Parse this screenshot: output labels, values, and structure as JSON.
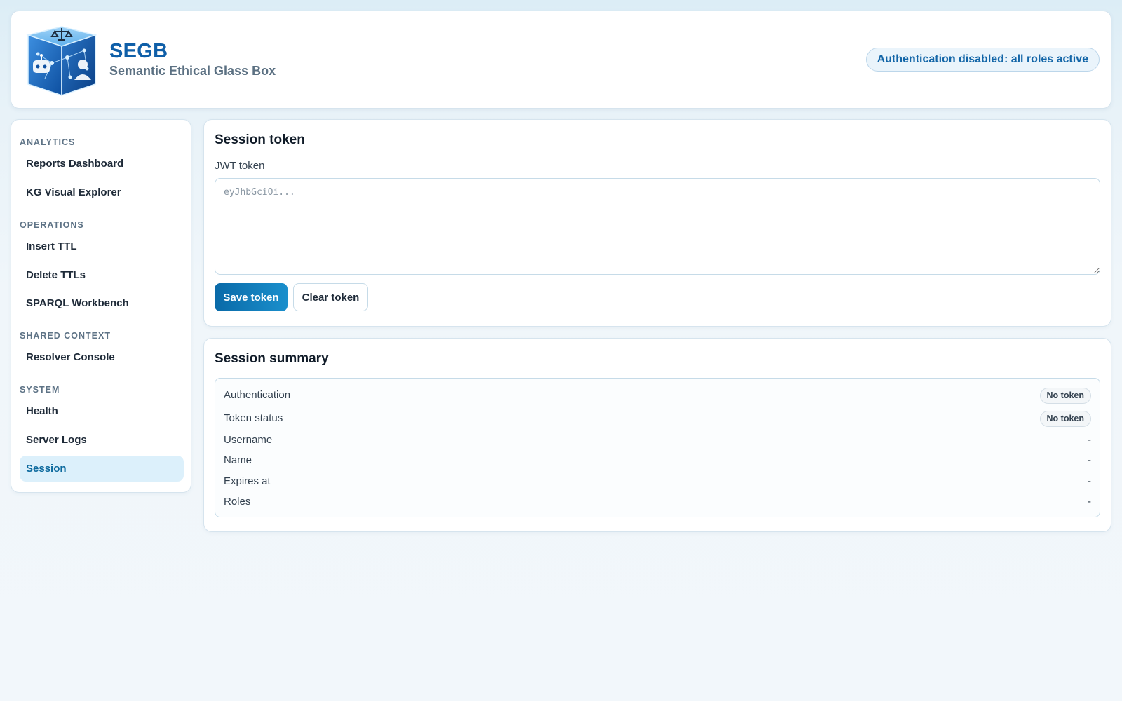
{
  "header": {
    "title": "SEGB",
    "subtitle": "Semantic Ethical Glass Box",
    "auth_status": "Authentication disabled: all roles active",
    "logo_icon": "robot-and-person-cube-with-scales-icon"
  },
  "sidebar": {
    "sections": [
      {
        "heading": "ANALYTICS",
        "items": [
          "Reports Dashboard",
          "KG Visual Explorer"
        ]
      },
      {
        "heading": "OPERATIONS",
        "items": [
          "Insert TTL",
          "Delete TTLs",
          "SPARQL Workbench"
        ]
      },
      {
        "heading": "SHARED CONTEXT",
        "items": [
          "Resolver Console"
        ]
      },
      {
        "heading": "SYSTEM",
        "items": [
          "Health",
          "Server Logs",
          "Session"
        ]
      }
    ],
    "active_item": "Session"
  },
  "session_token": {
    "title": "Session token",
    "field_label": "JWT token",
    "placeholder": "eyJhbGciOi...",
    "value": "",
    "save_label": "Save token",
    "clear_label": "Clear token"
  },
  "session_summary": {
    "title": "Session summary",
    "rows": [
      {
        "label": "Authentication",
        "value": "No token"
      },
      {
        "label": "Token status",
        "value": "No token"
      },
      {
        "label": "Username",
        "value": "-"
      },
      {
        "label": "Name",
        "value": "-"
      },
      {
        "label": "Expires at",
        "value": "-"
      },
      {
        "label": "Roles",
        "value": "-"
      }
    ]
  },
  "colors": {
    "accent": "#0f5fa8",
    "active_nav_bg": "#dcf0fb",
    "primary_button": "#0a6aa8"
  }
}
